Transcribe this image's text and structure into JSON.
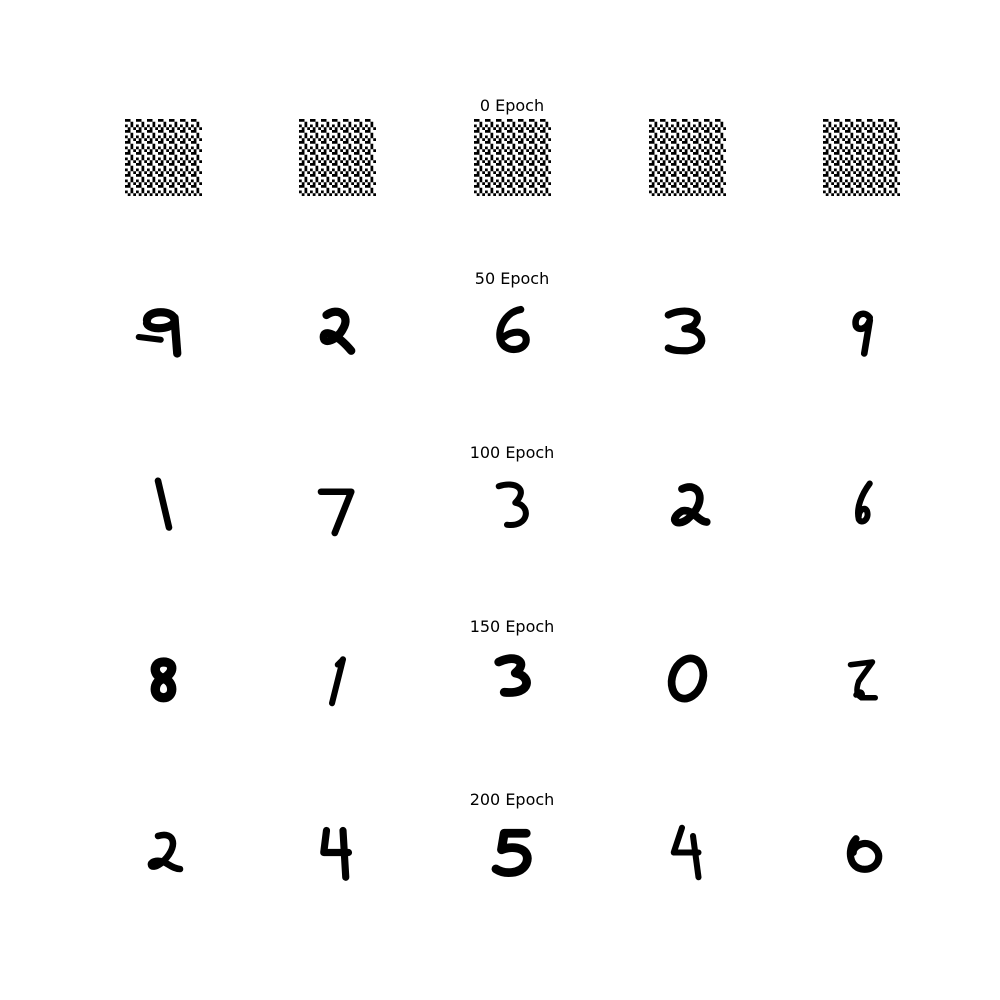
{
  "figure": {
    "rows": [
      {
        "title": "0 Epoch",
        "samples": [
          {
            "kind": "noise"
          },
          {
            "kind": "noise"
          },
          {
            "kind": "noise"
          },
          {
            "kind": "noise"
          },
          {
            "kind": "noise"
          }
        ]
      },
      {
        "title": "50 Epoch",
        "samples": [
          {
            "kind": "digit",
            "digit": "9"
          },
          {
            "kind": "digit",
            "digit": "2"
          },
          {
            "kind": "digit",
            "digit": "6"
          },
          {
            "kind": "digit",
            "digit": "3"
          },
          {
            "kind": "digit",
            "digit": "9"
          }
        ]
      },
      {
        "title": "100 Epoch",
        "samples": [
          {
            "kind": "digit",
            "digit": "1"
          },
          {
            "kind": "digit",
            "digit": "7"
          },
          {
            "kind": "digit",
            "digit": "3"
          },
          {
            "kind": "digit",
            "digit": "2"
          },
          {
            "kind": "digit",
            "digit": "6"
          }
        ]
      },
      {
        "title": "150 Epoch",
        "samples": [
          {
            "kind": "digit",
            "digit": "8"
          },
          {
            "kind": "digit",
            "digit": "1"
          },
          {
            "kind": "digit",
            "digit": "3"
          },
          {
            "kind": "digit",
            "digit": "0"
          },
          {
            "kind": "digit",
            "digit": "2"
          }
        ]
      },
      {
        "title": "200 Epoch",
        "samples": [
          {
            "kind": "digit",
            "digit": "2"
          },
          {
            "kind": "digit",
            "digit": "4"
          },
          {
            "kind": "digit",
            "digit": "5"
          },
          {
            "kind": "digit",
            "digit": "4"
          },
          {
            "kind": "digit",
            "digit": "0"
          }
        ]
      }
    ],
    "colors": {
      "ink": "#000000",
      "background": "#ffffff"
    }
  }
}
